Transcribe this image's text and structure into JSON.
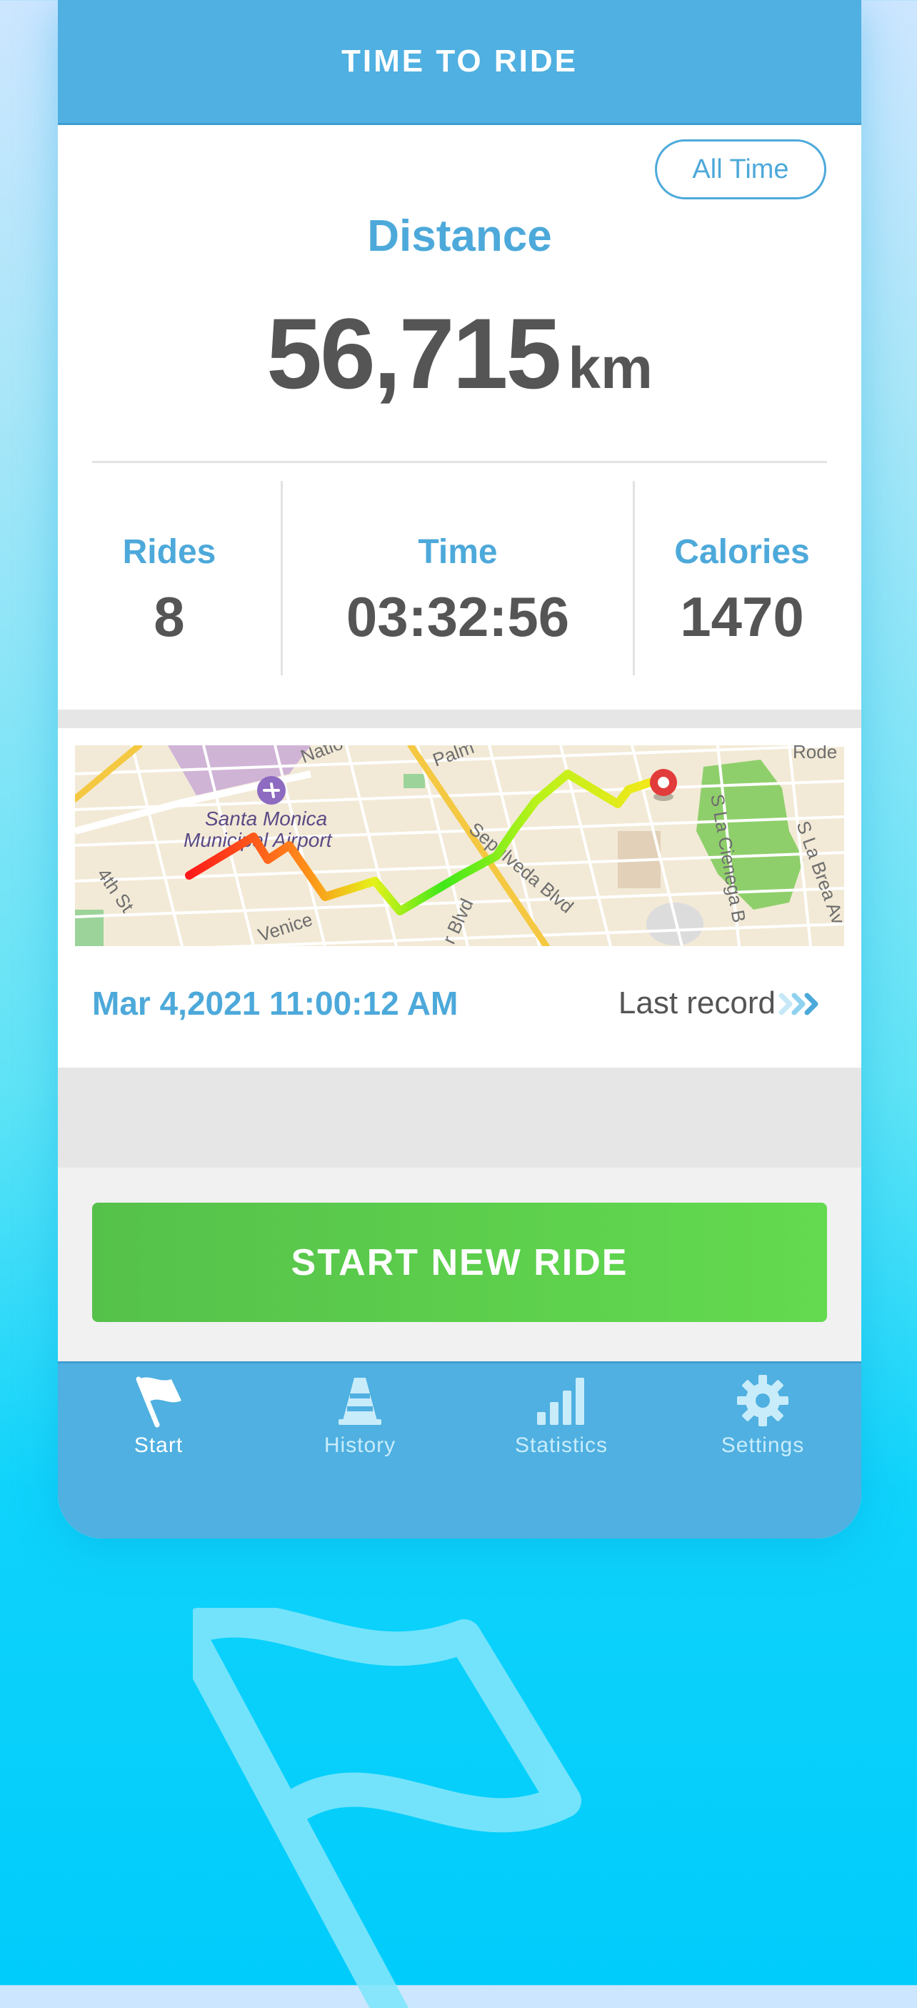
{
  "header": {
    "title": "TIME TO RIDE"
  },
  "filter": {
    "label": "All Time"
  },
  "distance": {
    "label": "Distance",
    "value": "56,715",
    "unit": "km"
  },
  "stats": [
    {
      "label": "Rides",
      "value": "8"
    },
    {
      "label": "Time",
      "value": "03:32:56"
    },
    {
      "label": "Calories",
      "value": "1470"
    }
  ],
  "map": {
    "labels": {
      "airport_line1": "Santa Monica",
      "airport_line2": "Municipal Airport",
      "street_4th": "4th St",
      "street_venice": "Venice",
      "street_sepulveda": "Sepulveda Blvd",
      "street_blvd": "r Blvd",
      "street_cienega": "S La Cienega B",
      "street_brea": "S La Brea Av",
      "street_natio": "Natio",
      "street_palm": "Palm",
      "street_rode": "Rode"
    }
  },
  "last_ride": {
    "datetime": "Mar 4,2021 11:00:12 AM",
    "link_label": "Last record"
  },
  "start_button": {
    "label": "START NEW RIDE"
  },
  "tabs": [
    {
      "label": "Start",
      "icon": "flag-icon",
      "active": true
    },
    {
      "label": "History",
      "icon": "cone-icon",
      "active": false
    },
    {
      "label": "Statistics",
      "icon": "bar-chart-icon",
      "active": false
    },
    {
      "label": "Settings",
      "icon": "gear-icon",
      "active": false
    }
  ],
  "colors": {
    "brand_blue": "#4fb0e1",
    "accent_text": "#4da9da",
    "start_green": "#5fd24e"
  }
}
